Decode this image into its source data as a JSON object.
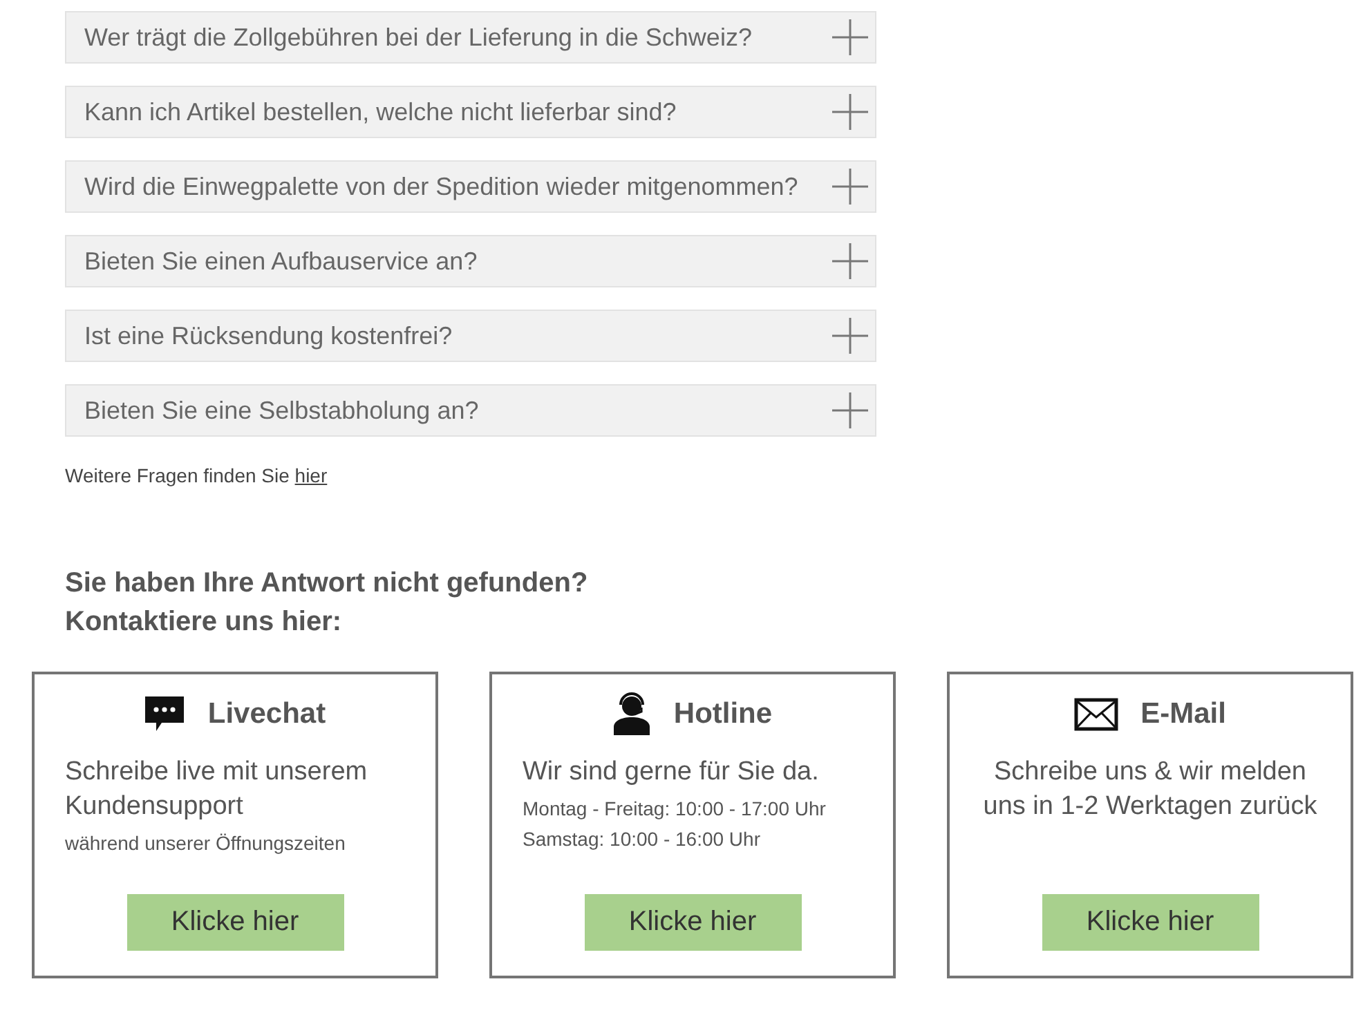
{
  "faq": {
    "items": [
      {
        "question": "Wer trägt die Zollgebühren bei der Lieferung in die Schweiz?",
        "expanded": false
      },
      {
        "question": "Kann ich Artikel bestellen, welche nicht lieferbar sind?",
        "expanded": false
      },
      {
        "question": "Wird die Einwegpalette von der Spedition wieder mitgenommen?",
        "expanded": false
      },
      {
        "question": "Bieten Sie einen Aufbauservice an?",
        "expanded": false
      },
      {
        "question": "Ist eine Rücksendung kostenfrei?",
        "expanded": false
      },
      {
        "question": "Bieten Sie eine Selbstabholung an?",
        "expanded": false
      }
    ],
    "more": {
      "text": "Weitere Fragen finden Sie",
      "link": "hier"
    }
  },
  "contact": {
    "heading": [
      "Sie haben Ihre Antwort nicht gefunden?",
      "Kontaktiere uns hier:"
    ],
    "cards": [
      {
        "kind": "chat",
        "title": "Livechat",
        "lines": [
          {
            "kind": "lead",
            "text": "Schreibe live mit unserem Kundensupport"
          },
          {
            "kind": "note",
            "text": "während unserer Öffnungszeiten"
          }
        ],
        "button": "Klicke hier"
      },
      {
        "kind": "hotline",
        "title": "Hotline",
        "lines": [
          {
            "kind": "lead",
            "text": "Wir sind gerne für Sie da."
          },
          {
            "kind": "note",
            "text": "Montag - Freitag: 10:00 - 17:00 Uhr"
          },
          {
            "kind": "note",
            "text": "Samstag: 10:00 - 16:00 Uhr"
          }
        ],
        "button": "Klicke hier"
      },
      {
        "kind": "mail",
        "title": "E-Mail",
        "lines": [
          {
            "kind": "lead",
            "text": "Schreibe uns & wir melden uns in 1-2 Werktagen zurück"
          }
        ],
        "button": "Klicke hier"
      }
    ]
  }
}
